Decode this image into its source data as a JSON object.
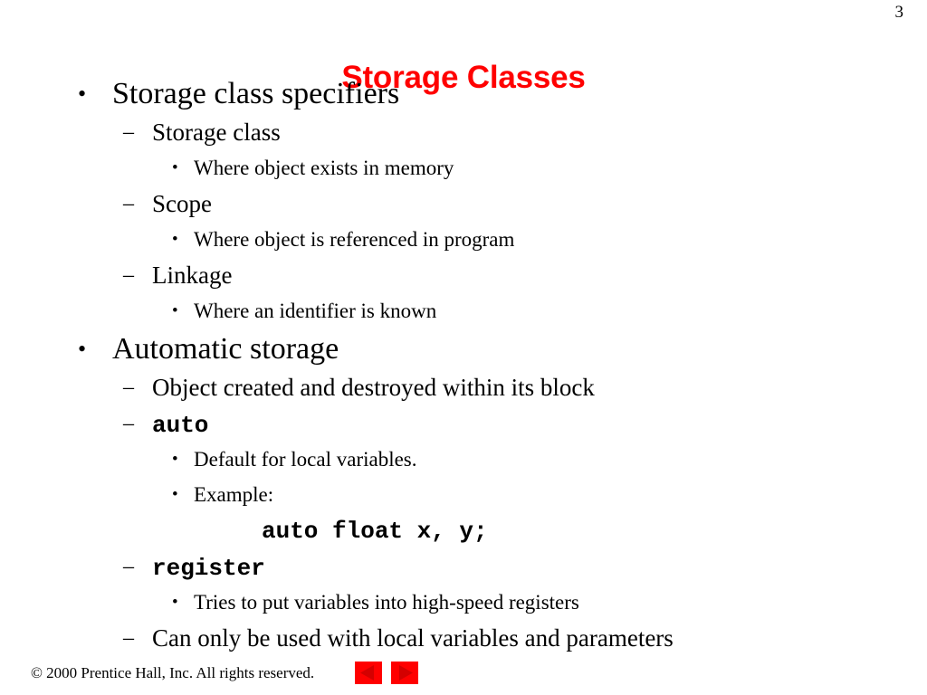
{
  "slide": {
    "page_number": "3",
    "title": "Storage Classes",
    "title_color": "#FF0000",
    "background_color": "#FFFFFF"
  },
  "content": {
    "lines": [
      {
        "level": 1,
        "marker": "•",
        "text": "Storage class specifiers",
        "code": false
      },
      {
        "level": 2,
        "marker": "–",
        "text": "Storage class",
        "code": false
      },
      {
        "level": 3,
        "marker": "•",
        "text": "Where object exists in memory",
        "code": false
      },
      {
        "level": 2,
        "marker": "–",
        "text": "Scope",
        "code": false
      },
      {
        "level": 3,
        "marker": "•",
        "text": "Where object is referenced in program",
        "code": false
      },
      {
        "level": 2,
        "marker": "–",
        "text": "Linkage",
        "code": false
      },
      {
        "level": 3,
        "marker": "•",
        "text": "Where an identifier is known",
        "code": false
      },
      {
        "level": 1,
        "marker": "•",
        "text": "Automatic storage",
        "code": false
      },
      {
        "level": 2,
        "marker": "–",
        "text": "Object created and destroyed within its block",
        "code": false
      },
      {
        "level": 2,
        "marker": "–",
        "text": "auto",
        "code": true
      },
      {
        "level": 3,
        "marker": "•",
        "text": "Default for local variables.",
        "code": false
      },
      {
        "level": 3,
        "marker": "•",
        "text": "Example:",
        "code": false
      },
      {
        "level": 0,
        "marker": "",
        "text": "auto float x, y;",
        "code": true
      },
      {
        "level": 2,
        "marker": "–",
        "text": "register",
        "code": true
      },
      {
        "level": 3,
        "marker": "•",
        "text": "Tries to put variables into high-speed registers",
        "code": false
      },
      {
        "level": 2,
        "marker": "–",
        "text": "Can only be used with local variables and parameters",
        "code": false
      }
    ]
  },
  "footer": {
    "copyright": "© 2000 Prentice Hall, Inc.  All rights reserved.",
    "nav": {
      "prev_label": "Previous slide",
      "next_label": "Next slide",
      "button_color": "#FF0000",
      "arrow_color": "#D40000"
    }
  }
}
